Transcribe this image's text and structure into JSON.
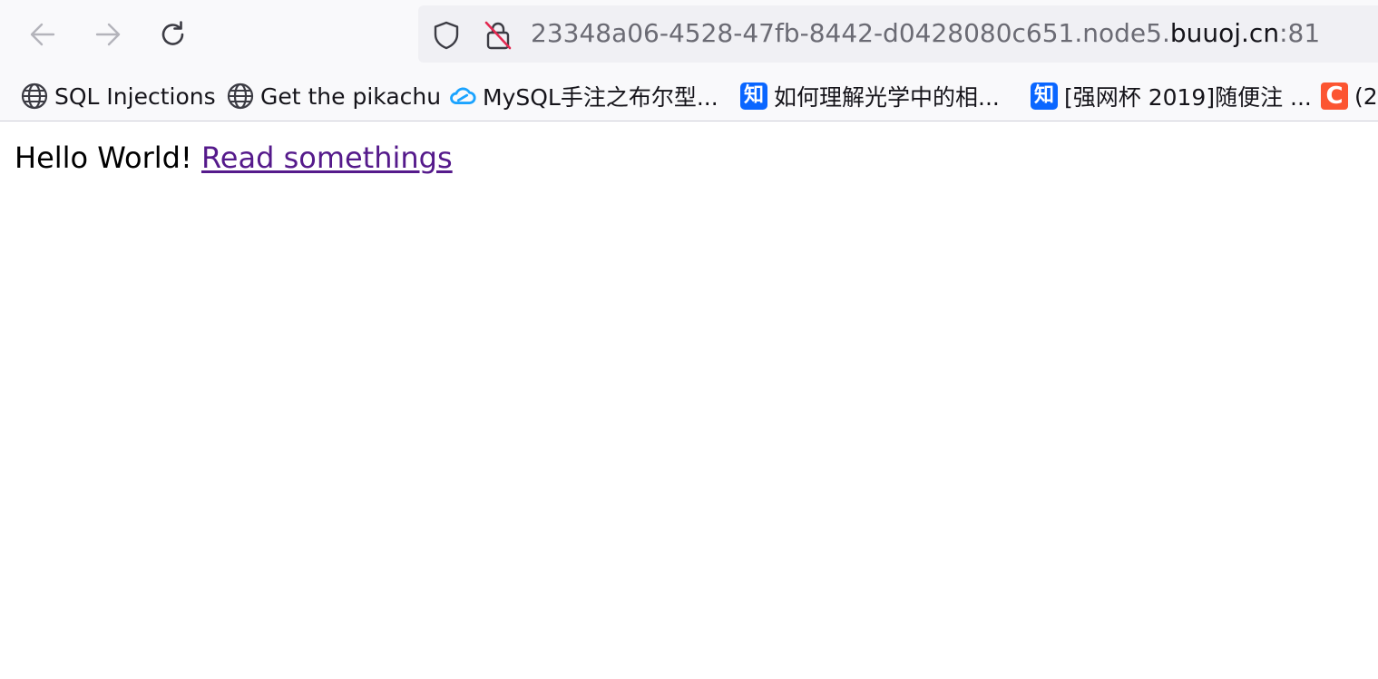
{
  "browser": {
    "nav": {
      "back_icon": "arrow-left-icon",
      "forward_icon": "arrow-right-icon",
      "reload_icon": "reload-icon"
    },
    "urlbar": {
      "url_prefix": "23348a06-4528-47fb-8442-d0428080c651.node5.",
      "url_host": "buuoj.cn",
      "url_suffix": ":81",
      "shield_icon": "shield-icon",
      "lock_icon": "insecure-lock-icon"
    },
    "bookmarks": [
      {
        "label": "SQL Injections",
        "icon": "globe-icon"
      },
      {
        "label": "Get the pikachu",
        "icon": "globe-icon"
      },
      {
        "label": "MySQL手注之布尔型...",
        "icon": "cloud-icon"
      },
      {
        "label": "如何理解光学中的相...",
        "icon": "zhihu-icon",
        "icon_text": "知"
      },
      {
        "label": "[强网杯 2019]随便注 ...",
        "icon": "zhihu-icon",
        "icon_text": "知"
      },
      {
        "label": "(2",
        "icon": "csdn-icon",
        "icon_text": "C"
      }
    ]
  },
  "page": {
    "greeting": "Hello World!",
    "link_text": "Read somethings"
  },
  "colors": {
    "link_visited": "#551a8b",
    "zhihu_blue": "#0a66ff",
    "csdn_red": "#fc5531",
    "cloud_blue": "#1aa3ff"
  }
}
